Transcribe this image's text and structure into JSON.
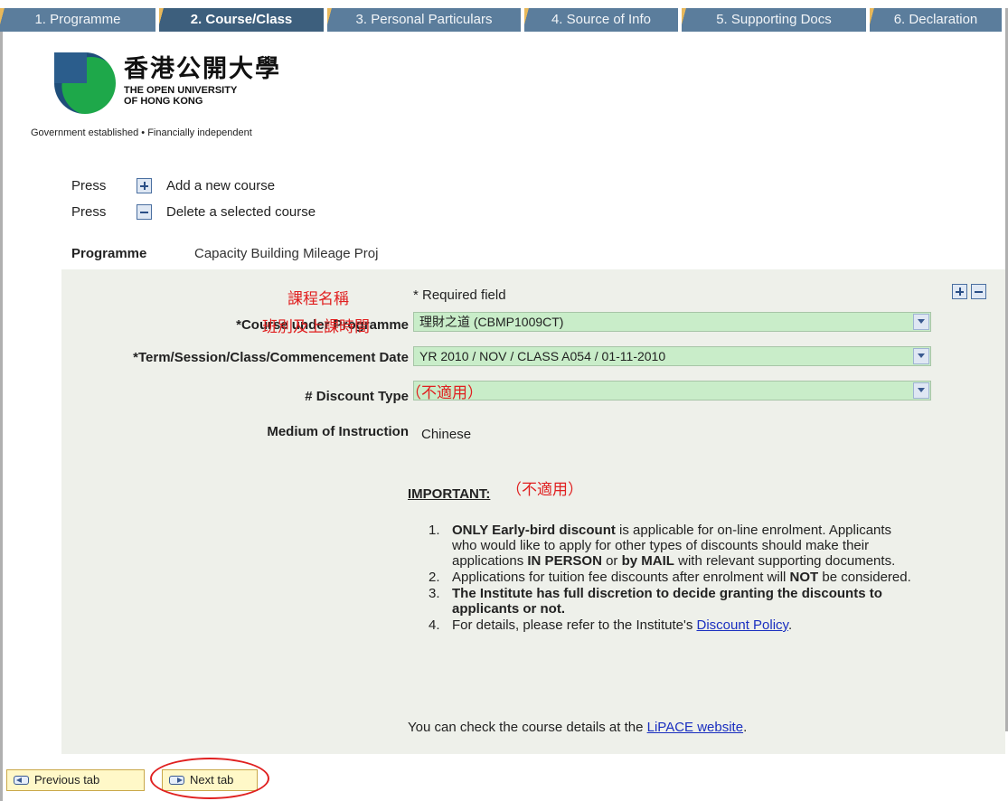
{
  "tabs": [
    {
      "label": "1. Programme",
      "active": false
    },
    {
      "label": "2. Course/Class",
      "active": true
    },
    {
      "label": "3. Personal Particulars",
      "active": false
    },
    {
      "label": "4. Source of Info",
      "active": false
    },
    {
      "label": "5. Supporting Docs",
      "active": false
    },
    {
      "label": "6. Declaration",
      "active": false
    }
  ],
  "logo": {
    "name_cn": "香港公開大學",
    "name_en_line1": "THE OPEN UNIVERSITY",
    "name_en_line2": "OF HONG KONG",
    "tagline": "Government established • Financially independent"
  },
  "instructions": {
    "press_word": "Press",
    "add_text": "Add a new course",
    "delete_text": "Delete a selected course"
  },
  "programme": {
    "label": "Programme",
    "value": "Capacity Building Mileage Proj"
  },
  "form": {
    "required_note": "* Required field",
    "annotation_course": "課程名稱",
    "annotation_term": "班別及上課時間",
    "annotation_discount": "（不適用）",
    "annotation_important": "（不適用）",
    "course_label": "*Course under Programme",
    "course_value": "理財之道 (CBMP1009CT)",
    "term_label": "*Term/Session/Class/Commencement Date",
    "term_value": "YR 2010 / NOV / CLASS A054 / 01-11-2010",
    "discount_label": "# Discount Type",
    "discount_value": "",
    "medium_label": "Medium of Instruction",
    "medium_value": "Chinese"
  },
  "important": {
    "heading": "IMPORTANT:",
    "items": [
      {
        "num": "1.",
        "b1": "ONLY Early-bird discount",
        "t1": " is applicable for on-line enrolment. Applicants who would like to apply for other types of discounts should make their applications ",
        "b2": "IN PERSON",
        "t2": " or ",
        "b3": "by MAIL",
        "t3": " with relevant supporting documents."
      },
      {
        "num": "2.",
        "t1": "Applications for tuition fee discounts after enrolment will ",
        "b1": "NOT",
        "t2": " be considered."
      },
      {
        "num": "3.",
        "b1": "The Institute has full discretion to decide granting the discounts to applicants or not."
      },
      {
        "num": "4.",
        "t1": "For details, please refer to the Institute's ",
        "link": "Discount Policy",
        "t2": "."
      }
    ],
    "check_text": "You can check the course details at the ",
    "check_link": "LiPACE website",
    "check_end": "."
  },
  "nav": {
    "prev_label": "Previous tab",
    "next_label": "Next tab"
  },
  "colors": {
    "tab_bg": "#5b7d9c",
    "tab_active_bg": "#3d5f7d",
    "select_bg": "#c9edc9",
    "annotation": "#e02020",
    "panel_bg": "#eef0ea"
  }
}
